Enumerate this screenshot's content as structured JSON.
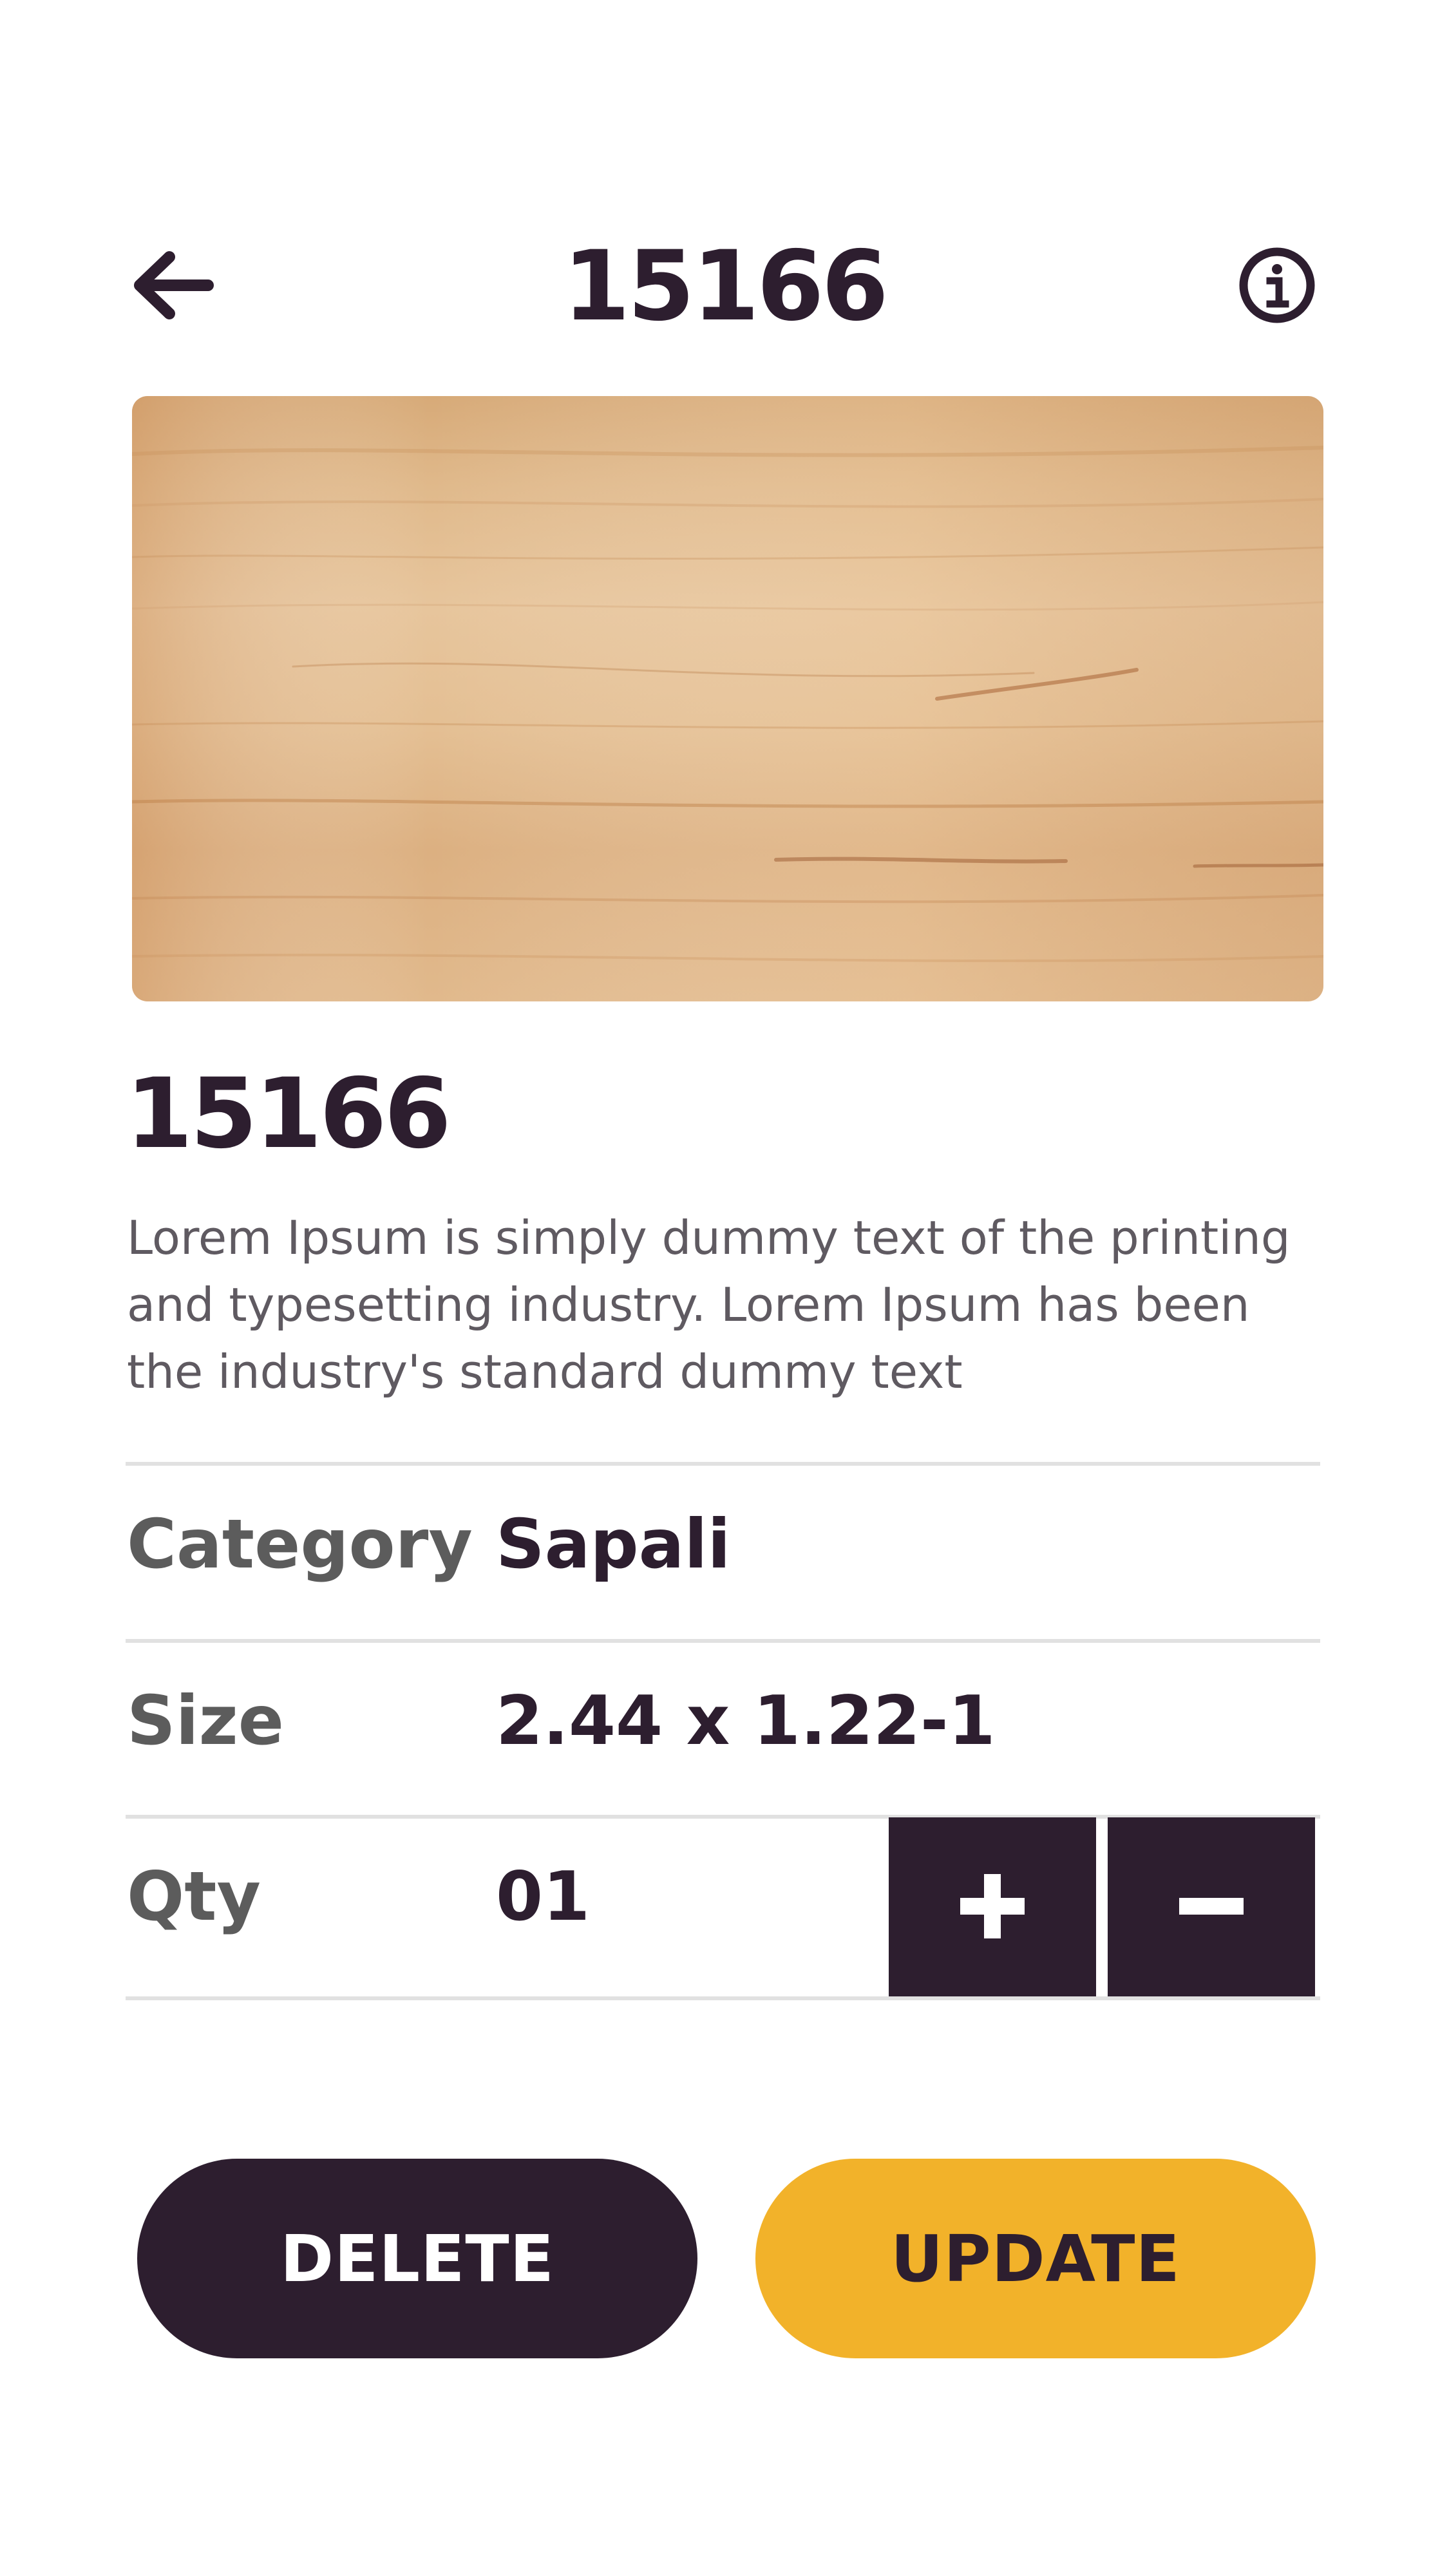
{
  "header": {
    "title": "15166",
    "back_icon": "arrow-left-icon",
    "info_icon": "info-circle-icon"
  },
  "product": {
    "name": "15166",
    "description": "Lorem Ipsum is simply dummy text of the printing and typesetting industry. Lorem Ipsum has been the industry's standard dummy text",
    "image": "wood-grain-sample"
  },
  "details": {
    "category": {
      "label": "Category",
      "value": "Sapali"
    },
    "size": {
      "label": "Size",
      "value": "2.44 x 1.22-1"
    },
    "qty": {
      "label": "Qty",
      "value": "01"
    }
  },
  "qty_controls": {
    "increment_icon": "plus-icon",
    "decrement_icon": "minus-icon"
  },
  "actions": {
    "delete_label": "DELETE",
    "update_label": "UPDATE"
  },
  "colors": {
    "primary_dark": "#2d1e2f",
    "accent": "#f2b22a",
    "divider": "#e1e1e1",
    "muted_text": "#5f5a61"
  }
}
